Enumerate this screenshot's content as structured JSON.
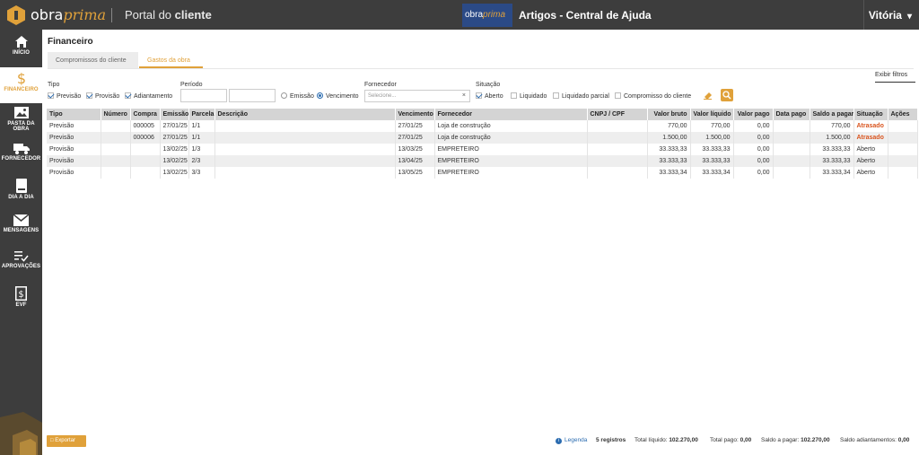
{
  "header": {
    "brand_a": "obra",
    "brand_b": "prima",
    "portal_a": "Portal do",
    "portal_b": "cliente",
    "help_logo_a": "obra",
    "help_logo_b": "prima",
    "help_text": "Artigos - Central de Ajuda",
    "user": "Vitória"
  },
  "sidebar": {
    "items": [
      {
        "label": "INÍCIO",
        "icon": "home-icon"
      },
      {
        "label": "FINANCEIRO",
        "icon": "dollar-icon"
      },
      {
        "label": "PASTA DA OBRA",
        "icon": "image-icon"
      },
      {
        "label": "FORNECEDOR",
        "icon": "truck-icon"
      },
      {
        "label": "DIA A DIA",
        "icon": "book-icon"
      },
      {
        "label": "MENSAGENS",
        "icon": "mail-icon"
      },
      {
        "label": "APROVAÇÕES",
        "icon": "check-list-icon"
      },
      {
        "label": "EVF",
        "icon": "dollar-doc-icon"
      }
    ]
  },
  "page": {
    "title": "Financeiro",
    "tabs": [
      "Compromissos do cliente",
      "Gastos da obra"
    ],
    "show_filters": "Exibir filtros"
  },
  "filters": {
    "tipo_label": "Tipo",
    "tipo_options": [
      "Previsão",
      "Provisão",
      "Adiantamento"
    ],
    "periodo_label": "Período",
    "periodo_options": [
      "Emissão",
      "Vencimento"
    ],
    "fornecedor_label": "Fornecedor",
    "fornecedor_placeholder": "Selecione...",
    "fornecedor_clear": "×",
    "situacao_label": "Situação",
    "situacao_options": [
      "Aberto",
      "Liquidado",
      "Liquidado parcial",
      "Compromisso do cliente"
    ]
  },
  "table": {
    "headers": [
      "Tipo",
      "Número",
      "Compra",
      "Emissão",
      "Parcela",
      "Descrição",
      "Vencimento",
      "Fornecedor",
      "CNPJ / CPF",
      "Valor bruto",
      "Valor líquido",
      "Valor pago",
      "Data pago",
      "Saldo a pagar",
      "Situação",
      "Ações"
    ],
    "rows": [
      [
        "Previsão",
        "",
        "000005",
        "27/01/25",
        "1/1",
        "",
        "27/01/25",
        "Loja de construção",
        "",
        "770,00",
        "770,00",
        "0,00",
        "",
        "770,00",
        "Atrasado",
        ""
      ],
      [
        "Previsão",
        "",
        "000006",
        "27/01/25",
        "1/1",
        "",
        "27/01/25",
        "Loja de construção",
        "",
        "1.500,00",
        "1.500,00",
        "0,00",
        "",
        "1.500,00",
        "Atrasado",
        ""
      ],
      [
        "Provisão",
        "",
        "",
        "13/02/25",
        "1/3",
        "",
        "13/03/25",
        "EMPRETEIRO",
        "",
        "33.333,33",
        "33.333,33",
        "0,00",
        "",
        "33.333,33",
        "Aberto",
        ""
      ],
      [
        "Provisão",
        "",
        "",
        "13/02/25",
        "2/3",
        "",
        "13/04/25",
        "EMPRETEIRO",
        "",
        "33.333,33",
        "33.333,33",
        "0,00",
        "",
        "33.333,33",
        "Aberto",
        ""
      ],
      [
        "Provisão",
        "",
        "",
        "13/02/25",
        "3/3",
        "",
        "13/05/25",
        "EMPRETEIRO",
        "",
        "33.333,34",
        "33.333,34",
        "0,00",
        "",
        "33.333,34",
        "Aberto",
        ""
      ]
    ]
  },
  "footer": {
    "export": "Exportar",
    "legend": "Legenda",
    "records": "5 registros",
    "total_liquido_label": "Total líquido:",
    "total_liquido": "102.270,00",
    "total_pago_label": "Total pago:",
    "total_pago": "0,00",
    "saldo_label": "Saldo a pagar:",
    "saldo": "102.270,00",
    "adiant_label": "Saldo adiantamentos:",
    "adiant": "0,00"
  },
  "colors": {
    "accent": "#e0a13a",
    "dark": "#3d3d3d",
    "late": "#d9541e",
    "link": "#2b6cb0"
  }
}
